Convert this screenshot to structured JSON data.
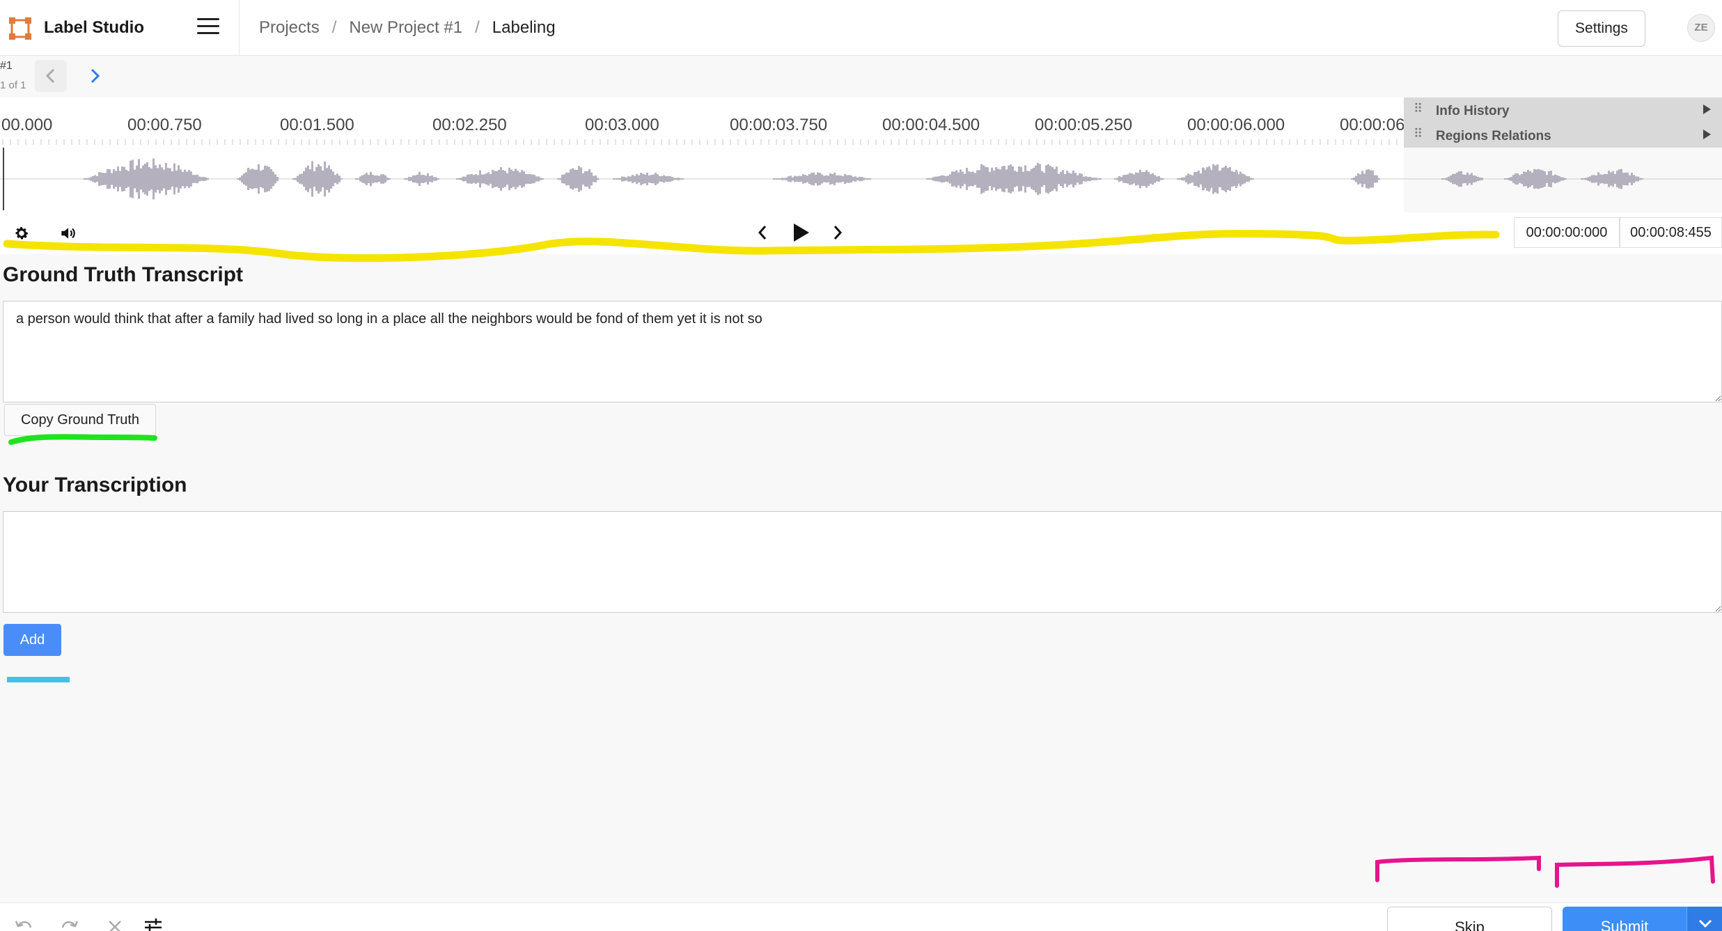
{
  "header": {
    "app_title": "Label Studio",
    "breadcrumb": [
      "Projects",
      "New Project #1",
      "Labeling"
    ],
    "breadcrumb_sep": "/",
    "settings_label": "Settings",
    "avatar_initials": "ZE"
  },
  "task_nav": {
    "task_id": "#1",
    "task_count": "1 of 1"
  },
  "timeline": {
    "labels": [
      "00.000",
      "00:00.750",
      "00:01.500",
      "00:02.250",
      "00:03.000",
      "00:00:03.750",
      "00:00:04.500",
      "00:00:05.250",
      "00:00:06.000",
      "00:00:06"
    ]
  },
  "side_panels": [
    {
      "label": "Info History"
    },
    {
      "label": "Regions Relations"
    }
  ],
  "audio_controls": {
    "current_time": "00:00:00:000",
    "duration": "00:00:08:455",
    "icons": [
      "settings-icon",
      "volume-icon",
      "seek-back-icon",
      "play-icon",
      "seek-forward-icon"
    ]
  },
  "ground_truth": {
    "heading": "Ground Truth Transcript",
    "text": "a person would think that after a family had lived so long in a place all the neighbors would be fond of them yet it is not so",
    "copy_button": "Copy Ground Truth"
  },
  "transcription": {
    "heading": "Your Transcription",
    "value": "",
    "add_button": "Add"
  },
  "bottom_bar": {
    "skip_label": "Skip",
    "submit_label": "Submit",
    "icons": [
      "undo-icon",
      "redo-icon",
      "reset-icon",
      "settings-sliders-icon"
    ]
  },
  "colors": {
    "accent": "#3d8ef7",
    "waveform": "#b4b0bd",
    "highlight_yellow": "#f5e400",
    "highlight_green": "#1fe31f",
    "highlight_cyan": "#3fc3ea",
    "highlight_magenta": "#e6148c"
  }
}
